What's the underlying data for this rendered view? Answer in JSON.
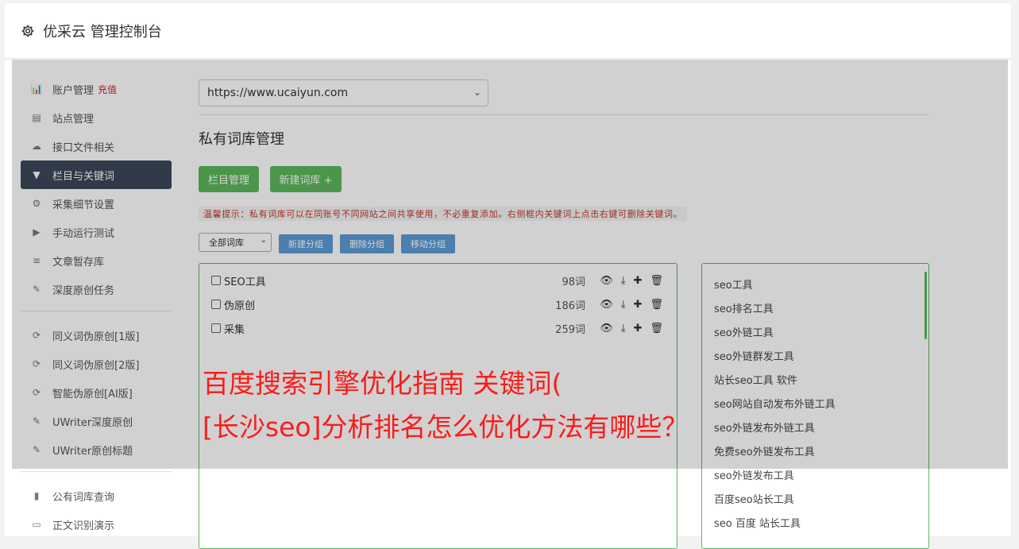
{
  "header": {
    "title": "优采云 管理控制台",
    "icon": "gear-icon"
  },
  "sidebar": {
    "items": [
      {
        "label": "账户管理",
        "extra": "充值",
        "icon": "bar-chart-icon"
      },
      {
        "label": "站点管理",
        "icon": "server-icon"
      },
      {
        "label": "接口文件相关",
        "icon": "cloud-upload-icon"
      },
      {
        "label": "栏目与关键词",
        "icon": "filter-icon",
        "active": true
      },
      {
        "label": "采集细节设置",
        "icon": "cogs-icon"
      },
      {
        "label": "手动运行测试",
        "icon": "play-circle-icon"
      },
      {
        "label": "文章暂存库",
        "icon": "database-icon"
      },
      {
        "label": "深度原创任务",
        "icon": "edit-icon"
      },
      {
        "label": "同义词伪原创[1版]",
        "icon": "refresh-icon"
      },
      {
        "label": "同义词伪原创[2版]",
        "icon": "refresh-icon"
      },
      {
        "label": "智能伪原创[AI版]",
        "icon": "refresh-icon"
      },
      {
        "label": "UWriter深度原创",
        "icon": "edit-icon"
      },
      {
        "label": "UWriter原创标题",
        "icon": "edit-icon"
      },
      {
        "label": "公有词库查询",
        "icon": "book-icon"
      },
      {
        "label": "正文识别演示",
        "icon": "monitor-icon"
      }
    ]
  },
  "main": {
    "site_select": "https://www.ucaiyun.com",
    "page_title": "私有词库管理",
    "buttons": {
      "columns": "栏目管理",
      "new_lib": "新建词库 +"
    },
    "tip": "温馨提示：私有词库可以在同账号不同网站之间共享使用，不必重复添加。右侧框内关键词上点击右键可删除关键词。",
    "lib_filter": "全部词库",
    "group_buttons": {
      "new_group": "新建分组",
      "delete_group": "删除分组",
      "move_group": "移动分组"
    },
    "groups": [
      {
        "name": "SEO工具",
        "count": "98词"
      },
      {
        "name": "伪原创",
        "count": "186词"
      },
      {
        "name": "采集",
        "count": "259词"
      }
    ],
    "keywords": [
      "seo工具",
      "seo排名工具",
      "seo外链工具",
      "seo外链群发工具",
      "站长seo工具 软件",
      "seo网站自动发布外链工具",
      "seo外链发布外链工具",
      "免费seo外链发布工具",
      "seo外链发布工具",
      "百度seo站长工具",
      "seo 百度 站长工具"
    ]
  },
  "overlay_headline": {
    "line1": "百度搜索引擎优化指南 关键词(",
    "line2": "[长沙seo]分析排名怎么优化方法有哪些？"
  },
  "colors": {
    "active_nav": "#3c4759",
    "green": "#5cb85c",
    "blue_btn": "#5b9bd5",
    "headline": "#ff1a1a",
    "recharge": "#e02020"
  }
}
